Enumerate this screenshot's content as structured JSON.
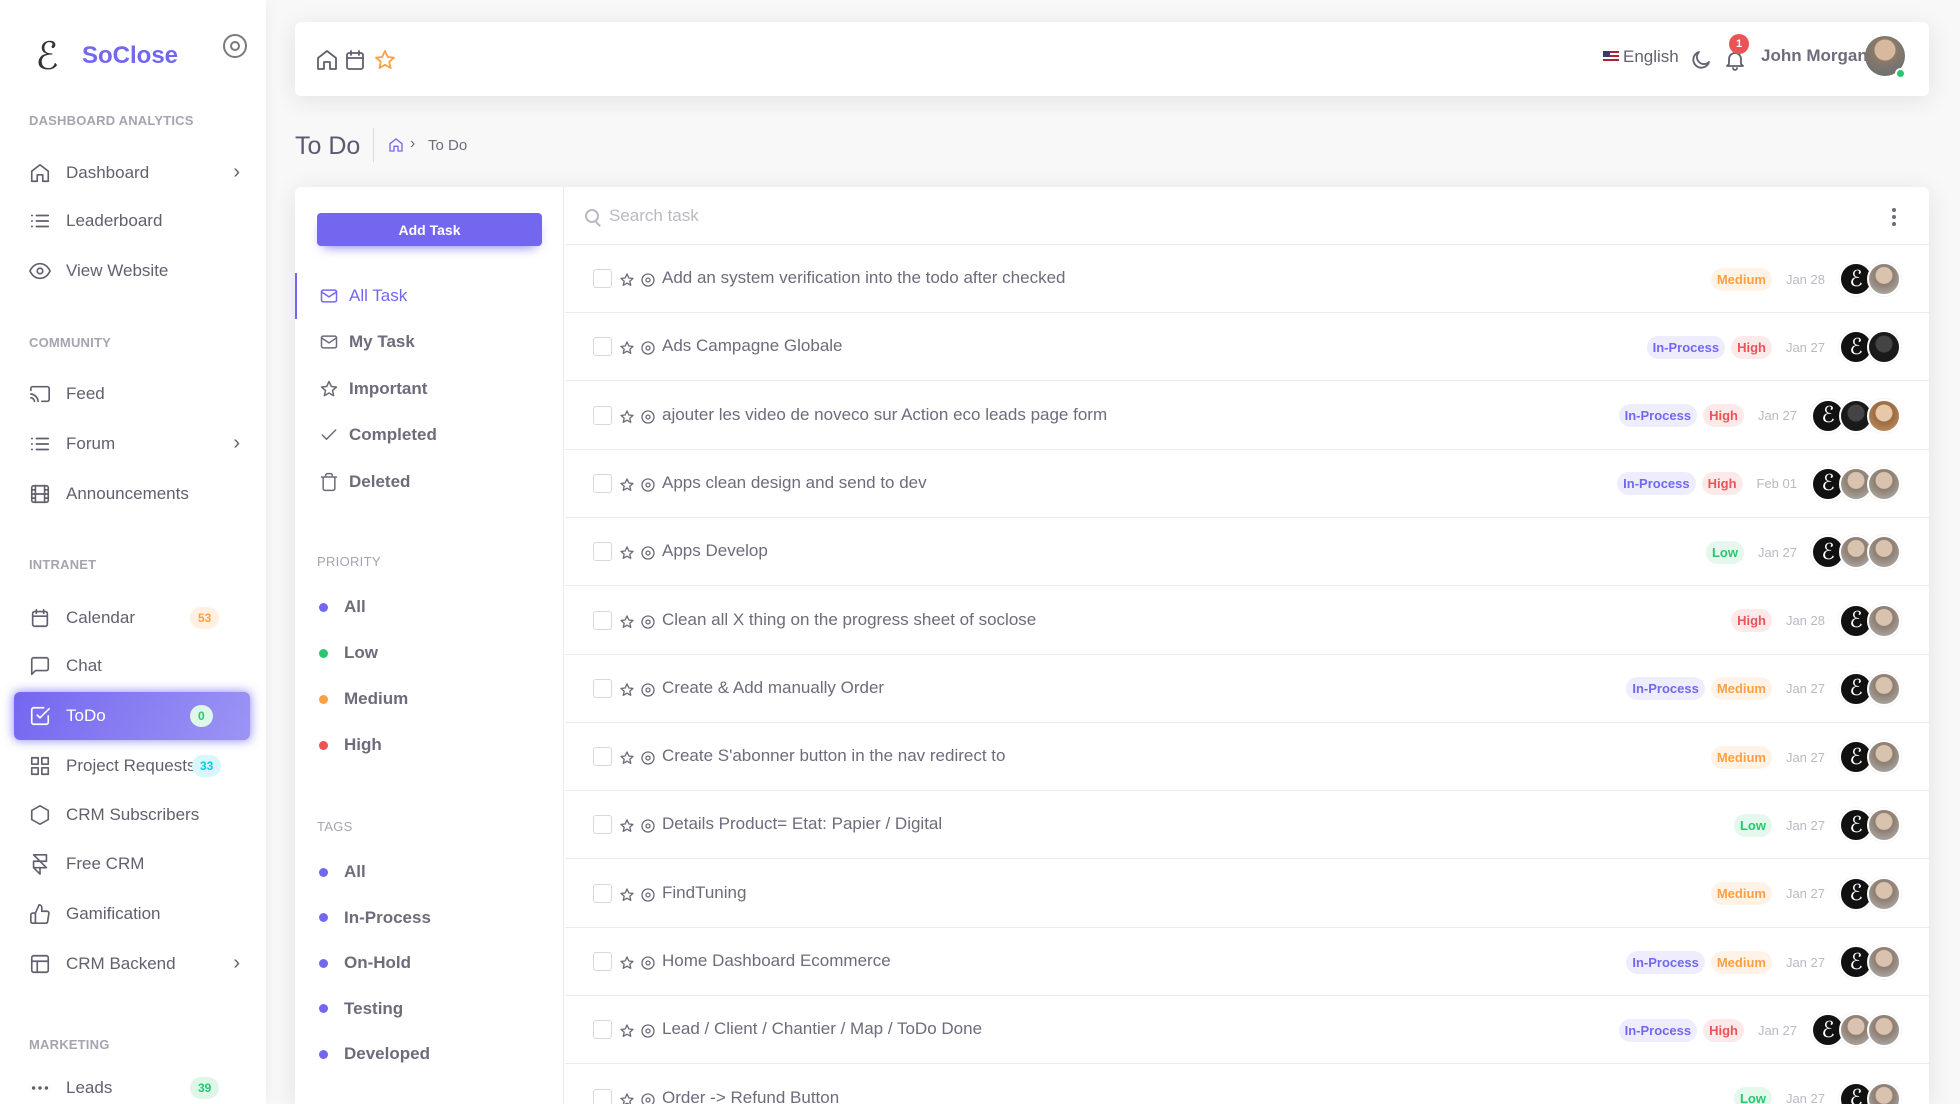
{
  "brand": {
    "logo_glyph": "ℰ",
    "name": "SoClose"
  },
  "sidebar": {
    "sections": [
      {
        "label": "DASHBOARD ANALYTICS"
      },
      {
        "label": "COMMUNITY"
      },
      {
        "label": "INTRANET"
      },
      {
        "label": "MARKETING"
      }
    ],
    "items": [
      {
        "label": "Dashboard",
        "icon": "home-icon",
        "chevron": "›"
      },
      {
        "label": "Leaderboard",
        "icon": "list-icon"
      },
      {
        "label": "View Website",
        "icon": "eye-icon"
      },
      {
        "label": "Feed",
        "icon": "cast-icon"
      },
      {
        "label": "Forum",
        "icon": "list-icon",
        "chevron": "›"
      },
      {
        "label": "Announcements",
        "icon": "film-icon"
      },
      {
        "label": "Calendar",
        "icon": "calendar-icon",
        "badge": "53"
      },
      {
        "label": "Chat",
        "icon": "message-icon"
      },
      {
        "label": "ToDo",
        "icon": "check-square-icon",
        "badge": "0",
        "active": true
      },
      {
        "label": "Project Requests",
        "icon": "grid-icon",
        "badge": "33"
      },
      {
        "label": "CRM Subscribers",
        "icon": "hexagon-icon"
      },
      {
        "label": "Free CRM",
        "icon": "framer-icon"
      },
      {
        "label": "Gamification",
        "icon": "thumbs-up-icon"
      },
      {
        "label": "CRM Backend",
        "icon": "layout-icon",
        "chevron": "›"
      },
      {
        "label": "Leads",
        "icon": "more-horizontal-icon",
        "badge": "39"
      }
    ]
  },
  "navbar": {
    "language": "English",
    "notification_count": "1",
    "user_name": "John Morgan"
  },
  "page": {
    "title": "To Do",
    "breadcrumb_separator": "›",
    "breadcrumb_current": "To Do"
  },
  "todo_sidebar": {
    "add_task_label": "Add Task",
    "filters": [
      {
        "label": "All Task",
        "icon": "mail-icon",
        "active": true
      },
      {
        "label": "My Task",
        "icon": "mail-icon"
      },
      {
        "label": "Important",
        "icon": "star-icon"
      },
      {
        "label": "Completed",
        "icon": "check-icon"
      },
      {
        "label": "Deleted",
        "icon": "trash-icon"
      }
    ],
    "priority_label": "PRIORITY",
    "priorities": [
      {
        "label": "All",
        "color": "#7367f0"
      },
      {
        "label": "Low",
        "color": "#28c76f"
      },
      {
        "label": "Medium",
        "color": "#ff9f43"
      },
      {
        "label": "High",
        "color": "#ea5455"
      }
    ],
    "tags_label": "TAGS",
    "tags": [
      {
        "label": "All",
        "color": "#7367f0"
      },
      {
        "label": "In-Process",
        "color": "#7367f0"
      },
      {
        "label": "On-Hold",
        "color": "#7367f0"
      },
      {
        "label": "Testing",
        "color": "#7367f0"
      },
      {
        "label": "Developed",
        "color": "#7367f0"
      }
    ]
  },
  "search": {
    "placeholder": "Search task"
  },
  "tasks": [
    {
      "title": "Add an system verification into the todo after checked",
      "tags": [
        "Medium"
      ],
      "date": "Jan 28",
      "avatars": [
        "logo",
        "photo"
      ]
    },
    {
      "title": "Ads Campagne Globale",
      "tags": [
        "In-Process",
        "High"
      ],
      "date": "Jan 27",
      "avatars": [
        "logo",
        "dark"
      ]
    },
    {
      "title": "ajouter les video de noveco sur Action eco leads page form",
      "tags": [
        "In-Process",
        "High"
      ],
      "date": "Jan 27",
      "avatars": [
        "logo",
        "dark",
        "woman"
      ]
    },
    {
      "title": "Apps clean design and send to dev",
      "tags": [
        "In-Process",
        "High"
      ],
      "date": "Feb 01",
      "avatars": [
        "logo",
        "photo",
        "photo"
      ]
    },
    {
      "title": "Apps Develop",
      "tags": [
        "Low"
      ],
      "date": "Jan 27",
      "avatars": [
        "logo",
        "photo",
        "photo"
      ]
    },
    {
      "title": "Clean all X thing on the progress sheet of soclose",
      "tags": [
        "High"
      ],
      "date": "Jan 28",
      "avatars": [
        "logo",
        "photo"
      ]
    },
    {
      "title": "Create & Add manually Order",
      "tags": [
        "In-Process",
        "Medium"
      ],
      "date": "Jan 27",
      "avatars": [
        "logo",
        "photo"
      ]
    },
    {
      "title": "Create S'abonner button in the nav redirect to",
      "tags": [
        "Medium"
      ],
      "date": "Jan 27",
      "avatars": [
        "logo",
        "photo"
      ]
    },
    {
      "title": "Details Product= Etat: Papier / Digital",
      "tags": [
        "Low"
      ],
      "date": "Jan 27",
      "avatars": [
        "logo",
        "photo"
      ]
    },
    {
      "title": "FindTuning",
      "tags": [
        "Medium"
      ],
      "date": "Jan 27",
      "avatars": [
        "logo",
        "photo"
      ]
    },
    {
      "title": "Home Dashboard Ecommerce",
      "tags": [
        "In-Process",
        "Medium"
      ],
      "date": "Jan 27",
      "avatars": [
        "logo",
        "photo"
      ]
    },
    {
      "title": "Lead / Client / Chantier / Map / ToDo Done",
      "tags": [
        "In-Process",
        "High"
      ],
      "date": "Jan 27",
      "avatars": [
        "logo",
        "photo",
        "photo"
      ]
    },
    {
      "title": "Order -> Refund Button",
      "tags": [
        "Low"
      ],
      "date": "Jan 27",
      "avatars": [
        "logo",
        "photo"
      ]
    }
  ]
}
